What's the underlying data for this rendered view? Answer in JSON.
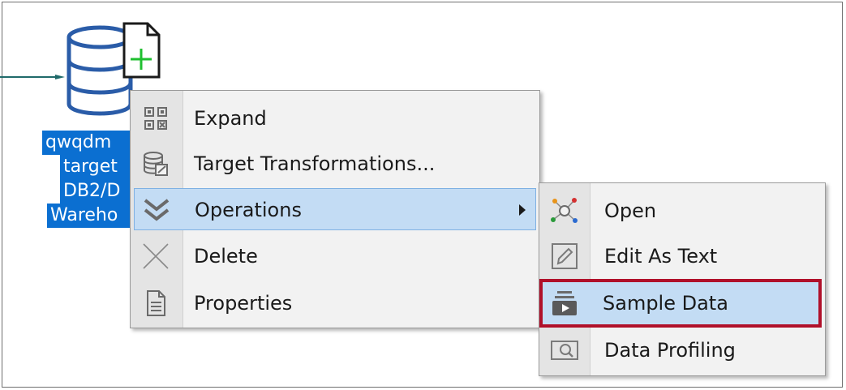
{
  "canvas": {
    "node_label_lines": [
      "qwqdm",
      "target",
      "DB2/D",
      "Wareho"
    ]
  },
  "context_menu": {
    "items": [
      {
        "label": "Expand",
        "icon": "expand-icon"
      },
      {
        "label": "Target Transformations...",
        "icon": "target-transformations-icon"
      },
      {
        "label": "Operations",
        "icon": "double-chevron-down-icon",
        "submenu": true,
        "highlighted": true
      },
      {
        "label": "Delete",
        "icon": "delete-x-icon"
      },
      {
        "label": "Properties",
        "icon": "properties-document-icon"
      }
    ]
  },
  "submenu": {
    "items": [
      {
        "label": "Open",
        "icon": "open-network-icon"
      },
      {
        "label": "Edit As Text",
        "icon": "edit-pencil-icon"
      },
      {
        "label": "Sample Data",
        "icon": "sample-data-icon",
        "emphasized": true
      },
      {
        "label": "Data Profiling",
        "icon": "data-profiling-icon"
      }
    ]
  },
  "colors": {
    "selection_blue": "#0b6fd1",
    "highlight": "#c3dcf4",
    "emphasis_border": "#b0102a",
    "db_icon_blue": "#2a5ca8",
    "connector_teal": "#1f6a6a",
    "plus_green": "#1fbf2f"
  }
}
